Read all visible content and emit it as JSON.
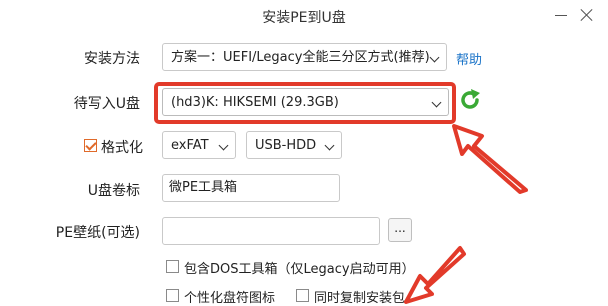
{
  "window": {
    "title": "安装PE到U盘",
    "minimize_icon": "minimize-icon",
    "close_icon": "close-icon"
  },
  "form": {
    "install_method": {
      "label": "安装方法",
      "value": "方案一：UEFI/Legacy全能三分区方式(推荐)",
      "help_link": "帮助"
    },
    "target_drive": {
      "label": "待写入U盘",
      "value": "(hd3)K: HIKSEMI (29.3GB)",
      "refresh_icon": "refresh-icon"
    },
    "format": {
      "label": "格式化",
      "checked": true,
      "filesystem": "exFAT",
      "mode": "USB-HDD"
    },
    "volume_label": {
      "label": "U盘卷标",
      "value": "微PE工具箱"
    },
    "wallpaper": {
      "label": "PE壁纸(可选)",
      "value": "",
      "browse_label": "..."
    },
    "options": {
      "include_dos": "包含DOS工具箱（仅Legacy启动可用）",
      "custom_icon": "个性化盘符图标",
      "copy_installer": "同时复制安装包"
    }
  },
  "colors": {
    "highlight": "#e23a2a",
    "link": "#1a73c8",
    "checkbox_accent": "#e06a2a",
    "refresh_green": "#3aa935"
  }
}
